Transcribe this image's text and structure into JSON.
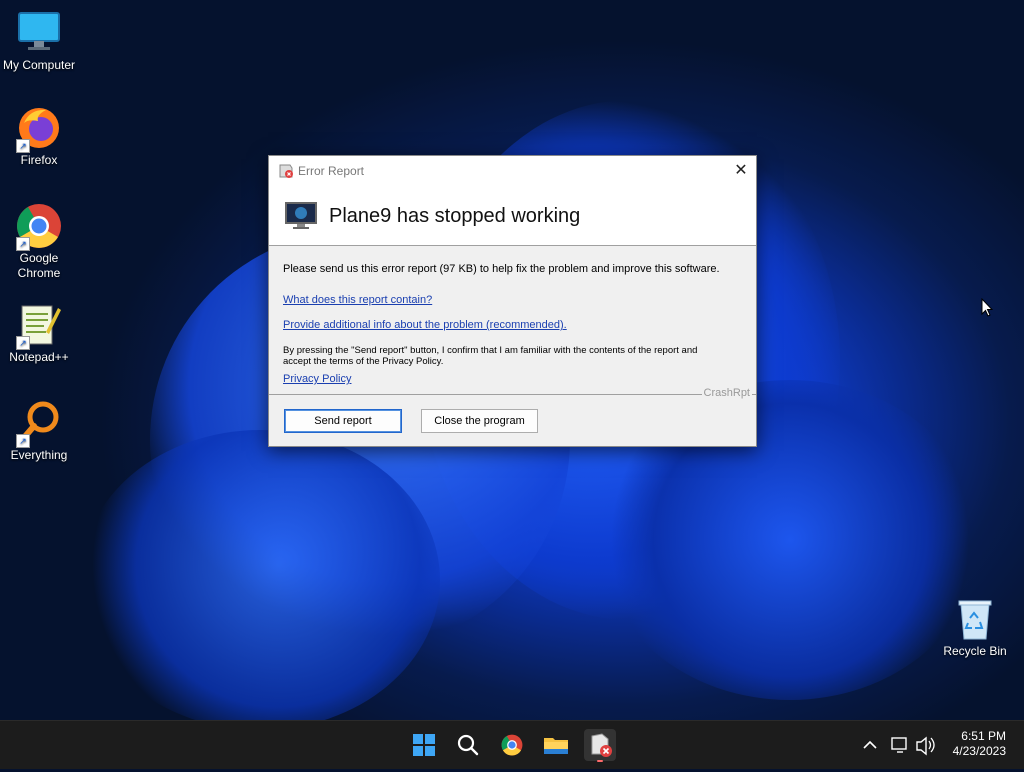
{
  "desktop": {
    "icons": [
      {
        "label": "My Computer",
        "icon": "monitor-icon"
      },
      {
        "label": "Firefox",
        "icon": "firefox-icon"
      },
      {
        "label": "Google Chrome",
        "icon": "chrome-icon"
      },
      {
        "label": "Notepad++",
        "icon": "notepadpp-icon"
      },
      {
        "label": "Everything",
        "icon": "everything-icon"
      },
      {
        "label": "Recycle Bin",
        "icon": "recycle-bin-icon"
      }
    ]
  },
  "dialog": {
    "title": "Error Report",
    "close_glyph": "✕",
    "heading": "Plane9 has stopped working",
    "message": "Please send us this error report (97 KB) to help fix the problem and improve this software.",
    "link_report_contents": "What does this report contain?",
    "link_additional_info": "Provide additional info about the problem (recommended).",
    "consent_text": "By pressing the \"Send report\" button, I confirm that I am familiar with the contents of the report and accept the terms of the Privacy Policy.",
    "link_privacy": "Privacy Policy",
    "brand": "CrashRpt",
    "send_button": "Send report",
    "close_button": "Close the program"
  },
  "taskbar": {
    "apps": [
      "start-icon",
      "search-icon",
      "chrome-icon",
      "file-explorer-icon",
      "crashrpt-icon"
    ],
    "active_app": "crashrpt-icon",
    "time": "6:51 PM",
    "date": "4/23/2023"
  },
  "colors": {
    "link": "#1a3fb0",
    "primary_border": "#2266cc",
    "taskbar_bg": "#1c1c1c"
  }
}
